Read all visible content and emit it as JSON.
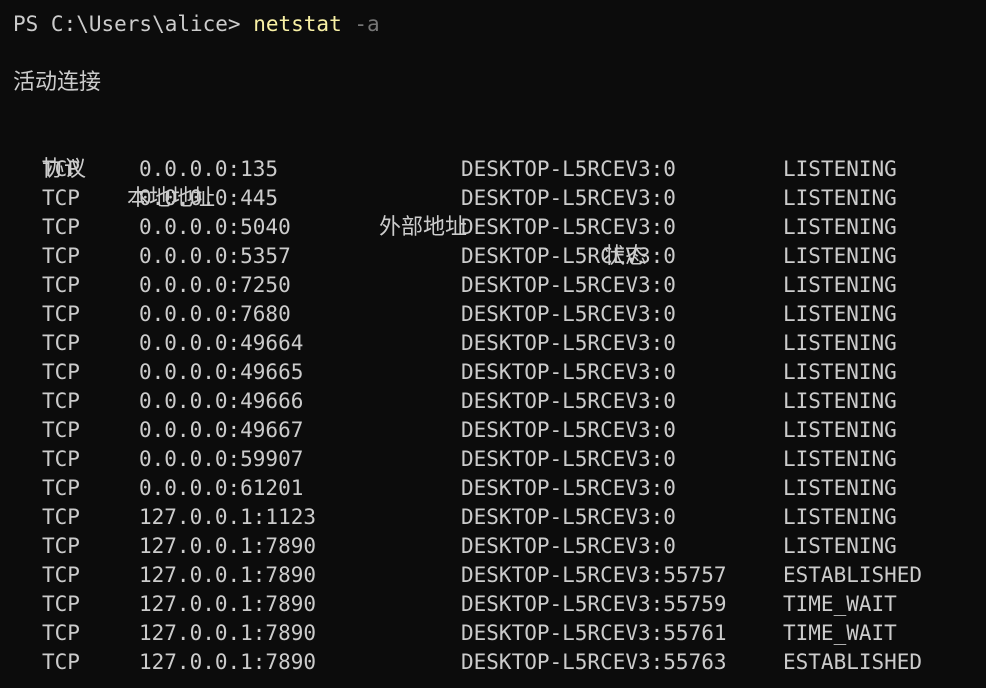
{
  "prompt": {
    "path": "PS C:\\Users\\alice> ",
    "command": "netstat",
    "argument": "-a"
  },
  "section_title": "活动连接",
  "headers": {
    "proto": "协议",
    "local": "本地地址",
    "foreign": "外部地址",
    "state": "状态"
  },
  "rows": [
    {
      "proto": "TCP",
      "local": "0.0.0.0:135",
      "foreign": "DESKTOP-L5RCEV3:0",
      "state": "LISTENING"
    },
    {
      "proto": "TCP",
      "local": "0.0.0.0:445",
      "foreign": "DESKTOP-L5RCEV3:0",
      "state": "LISTENING"
    },
    {
      "proto": "TCP",
      "local": "0.0.0.0:5040",
      "foreign": "DESKTOP-L5RCEV3:0",
      "state": "LISTENING"
    },
    {
      "proto": "TCP",
      "local": "0.0.0.0:5357",
      "foreign": "DESKTOP-L5RCEV3:0",
      "state": "LISTENING"
    },
    {
      "proto": "TCP",
      "local": "0.0.0.0:7250",
      "foreign": "DESKTOP-L5RCEV3:0",
      "state": "LISTENING"
    },
    {
      "proto": "TCP",
      "local": "0.0.0.0:7680",
      "foreign": "DESKTOP-L5RCEV3:0",
      "state": "LISTENING"
    },
    {
      "proto": "TCP",
      "local": "0.0.0.0:49664",
      "foreign": "DESKTOP-L5RCEV3:0",
      "state": "LISTENING"
    },
    {
      "proto": "TCP",
      "local": "0.0.0.0:49665",
      "foreign": "DESKTOP-L5RCEV3:0",
      "state": "LISTENING"
    },
    {
      "proto": "TCP",
      "local": "0.0.0.0:49666",
      "foreign": "DESKTOP-L5RCEV3:0",
      "state": "LISTENING"
    },
    {
      "proto": "TCP",
      "local": "0.0.0.0:49667",
      "foreign": "DESKTOP-L5RCEV3:0",
      "state": "LISTENING"
    },
    {
      "proto": "TCP",
      "local": "0.0.0.0:59907",
      "foreign": "DESKTOP-L5RCEV3:0",
      "state": "LISTENING"
    },
    {
      "proto": "TCP",
      "local": "0.0.0.0:61201",
      "foreign": "DESKTOP-L5RCEV3:0",
      "state": "LISTENING"
    },
    {
      "proto": "TCP",
      "local": "127.0.0.1:1123",
      "foreign": "DESKTOP-L5RCEV3:0",
      "state": "LISTENING"
    },
    {
      "proto": "TCP",
      "local": "127.0.0.1:7890",
      "foreign": "DESKTOP-L5RCEV3:0",
      "state": "LISTENING"
    },
    {
      "proto": "TCP",
      "local": "127.0.0.1:7890",
      "foreign": "DESKTOP-L5RCEV3:55757",
      "state": "ESTABLISHED"
    },
    {
      "proto": "TCP",
      "local": "127.0.0.1:7890",
      "foreign": "DESKTOP-L5RCEV3:55759",
      "state": "TIME_WAIT"
    },
    {
      "proto": "TCP",
      "local": "127.0.0.1:7890",
      "foreign": "DESKTOP-L5RCEV3:55761",
      "state": "TIME_WAIT"
    },
    {
      "proto": "TCP",
      "local": "127.0.0.1:7890",
      "foreign": "DESKTOP-L5RCEV3:55763",
      "state": "ESTABLISHED"
    }
  ],
  "colors": {
    "background": "#0c0c0c",
    "text": "#cccccc",
    "command": "#f9f1a5",
    "argument": "#767676"
  }
}
